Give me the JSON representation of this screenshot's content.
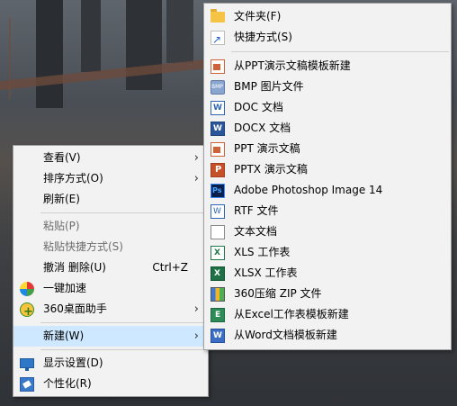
{
  "context_menu": {
    "items": [
      {
        "label": "查看(V)",
        "arrow": "›"
      },
      {
        "label": "排序方式(O)",
        "arrow": "›"
      },
      {
        "label": "刷新(E)"
      },
      {
        "label": "粘贴(P)"
      },
      {
        "label": "粘贴快捷方式(S)"
      },
      {
        "label": "撤消 删除(U)",
        "shortcut": "Ctrl+Z"
      },
      {
        "label": "一键加速",
        "icon": "speedup-icon"
      },
      {
        "label": "360桌面助手",
        "icon": "360-desktop-icon",
        "arrow": "›"
      },
      {
        "label": "新建(W)",
        "arrow": "›"
      },
      {
        "label": "显示设置(D)",
        "icon": "display-settings-icon"
      },
      {
        "label": "个性化(R)",
        "icon": "personalize-icon"
      }
    ]
  },
  "new_submenu": {
    "items": [
      {
        "label": "文件夹(F)",
        "icon": "folder-icon"
      },
      {
        "label": "快捷方式(S)",
        "icon": "shortcut-icon"
      },
      {
        "label": "从PPT演示文稿模板新建",
        "icon": "ppt-template-icon"
      },
      {
        "label": "BMP 图片文件",
        "icon": "bmp-icon"
      },
      {
        "label": "DOC 文档",
        "icon": "doc-icon"
      },
      {
        "label": "DOCX 文档",
        "icon": "docx-icon"
      },
      {
        "label": "PPT 演示文稿",
        "icon": "ppt-icon"
      },
      {
        "label": "PPTX 演示文稿",
        "icon": "pptx-icon"
      },
      {
        "label": "Adobe Photoshop Image 14",
        "icon": "photoshop-icon"
      },
      {
        "label": "RTF 文件",
        "icon": "rtf-icon"
      },
      {
        "label": "文本文档",
        "icon": "text-document-icon"
      },
      {
        "label": "XLS 工作表",
        "icon": "xls-icon"
      },
      {
        "label": "XLSX 工作表",
        "icon": "xlsx-icon"
      },
      {
        "label": "360压缩 ZIP 文件",
        "icon": "zip-icon"
      },
      {
        "label": "从Excel工作表模板新建",
        "icon": "excel-template-icon"
      },
      {
        "label": "从Word文档模板新建",
        "icon": "word-template-icon"
      }
    ]
  },
  "colors": {
    "menu_bg": "#f2f2f2",
    "highlight": "#cde8ff",
    "disabled_text": "#6d6d6d"
  }
}
